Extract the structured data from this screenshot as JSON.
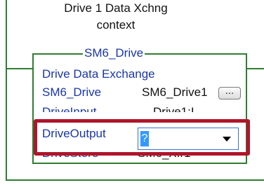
{
  "routine": {
    "title_line1": "Drive 1 Data Xchng",
    "title_line2": "context"
  },
  "block": {
    "name": "SM6_Drive",
    "type_label": "Drive Data Exchange",
    "instance_param": "SM6_Drive",
    "instance_value": "SM6_Drive1",
    "browse_label": "...",
    "input_param": "DriveInput",
    "input_value": "Drive1:I",
    "output_param": "DriveOutput",
    "output_value": "?",
    "store_param": "DriveStore",
    "store_value": "SM6_Xfr1"
  },
  "colors": {
    "rung": "#2e7d32",
    "param_text": "#1a36a8",
    "highlight": "#b0152b",
    "selection": "#3399ff"
  },
  "icons": {
    "dropdown": "chevron-down-icon"
  }
}
